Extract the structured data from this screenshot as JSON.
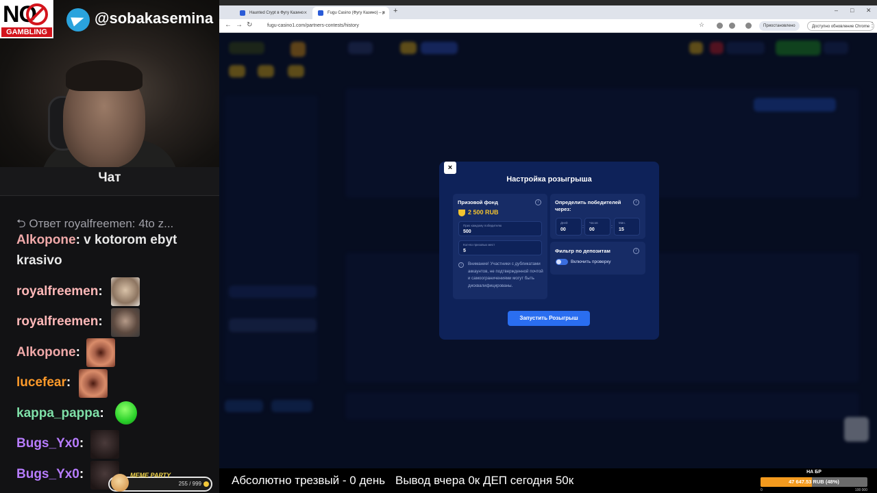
{
  "overlay": {
    "badge_big": "NO",
    "badge_small": "GAMBLING",
    "handle": "@sobakasemina",
    "chat_title": "Чат",
    "reply": "Ответ royalfreemen: 4to z...",
    "messages": [
      {
        "user": "Alkopone",
        "color": "#f0a9a9",
        "text": "v kotorom ebyt"
      },
      {
        "user": "",
        "color": "#e8e8e8",
        "text": "krasivo"
      },
      {
        "user": "royalfreemen",
        "color": "#ffb8b8",
        "text": ""
      },
      {
        "user": "royalfreemen",
        "color": "#ffb8b8",
        "text": ""
      },
      {
        "user": "Alkopone",
        "color": "#f0a9a9",
        "text": ""
      },
      {
        "user": "lucefear",
        "color": "#ff9a2a",
        "text": ""
      },
      {
        "user": "kappa_pappa",
        "color": "#7fe0a8",
        "text": ""
      },
      {
        "user": "Bugs_Yx0",
        "color": "#b77cff",
        "text": ""
      },
      {
        "user": "Bugs_Yx0",
        "color": "#b77cff",
        "text": ""
      }
    ],
    "meme_label": "MEME PARTY",
    "meme_count": "255 / 999"
  },
  "browser": {
    "tabs": [
      {
        "title": "Haunted Crypt в Фугу Казино"
      },
      {
        "title": "Fugu Casino (Фугу Казино) – p"
      }
    ],
    "new_tab": "+",
    "url": "fugu-casino1.com/partners-contests/history",
    "paused": "Приостановлено",
    "update": "Доступно обновление Chrome",
    "window_min": "–",
    "window_max": "□",
    "window_close": "✕"
  },
  "modal": {
    "title": "Настройка розыгрыша",
    "close": "×",
    "prize_label": "Призовой фонд",
    "prize_value": "2 500 RUB",
    "per_winner_label": "Приз каждому победителю",
    "per_winner_value": "500",
    "places_label": "Кол-во призовых мест",
    "places_value": "5",
    "warning": "Внимание! Участники с дубликатами аккаунтов, не подтвержденной почтой и самоограничениями могут быть дисквалифицированы.",
    "determine_label": "Определить победителей через:",
    "days_label": "Дней",
    "days_value": "00",
    "hours_label": "Часов",
    "hours_value": "00",
    "minutes_label": "Мин.",
    "minutes_value": "15",
    "deposit_filter_label": "Фильтр по депозитам",
    "toggle_label": "Включить проверку",
    "toggle_on": true,
    "launch_button": "Запустить Розыгрыш",
    "info_glyph": "i"
  },
  "ticker": {
    "text1": "Абсолютно трезвый - 0 день",
    "text2": "Вывод вчера 0к  ДЕП сегодня 50к"
  },
  "goal": {
    "title": "НА БР",
    "value_text": "47 647.53 RUB (48%)",
    "percent": 48,
    "min": "0",
    "max": "100 000",
    "fill_color": "#f39a1e"
  }
}
